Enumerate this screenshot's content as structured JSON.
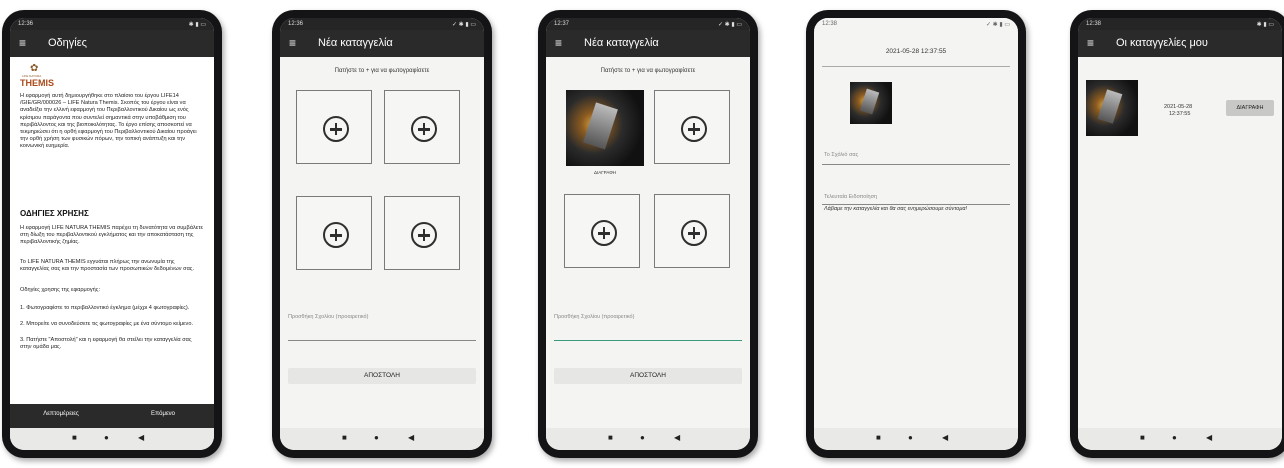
{
  "phones": [
    {
      "status_time": "12:36",
      "status_icons": "✱ ▮ ▭",
      "menu_icon": "≡",
      "title": "Οδηγίες",
      "logo_small": "LIFE NATURA",
      "logo_big": "THEMIS",
      "intro": "Η εφαρμογή αυτή δημιουργήθηκε στο πλαίσιο του έργου LIFE14 /GIE/GR/000026 – LIFE Natura Themis. Σκοπός του έργου είναι να αναδείξει την ελλινή εφαρμογή του Περιβαλλοντικού Δικαίου ως ενός κρίσιμου παράγοντα που συντελεί σημαντικά στην υποβάθμιση του περιβάλλοντος και της βιοποικιλότητας. Το έργο επίσης αποσκοπεί να τεκμηριώσει ότι η ορθή εφαρμογή του Περιβαλλοντικού Δικαίου προάγει την ορθή χρήση των φυσικών πόρων, την τοπική ανάπτυξη και την κοινωνική ευημερία.",
      "section_title": "ΟΔΗΓΙΕΣ ΧΡΗΣΗΣ",
      "para1": "Η εφαρμογή LIFE NATURA THEMIS παρέχει τη δυνατότητα να συμβάλετε στη δίωξη του περιβαλλοντικού εγκλήματος και την αποκατάσταση της περιβαλλοντικής ζημίας.",
      "para2": "Το LIFE NATURA THEMIS εγγυάται πλήρως την ανωνυμία της καταγγελίας σας και την προστασία των προσωπικών δεδομένων σας.",
      "para3": "Οδηγίες χρησης της εφαρμογής:",
      "step1": "1. Φωτογραφίστε το περιβαλλοντικό έγκλημα (μέχρι 4 φωτογραφίες).",
      "step2": "2. Μπορείτε να συνοδεύσετε τις φωτογραφίες με ένα σύντομο κείμενο.",
      "step3": "3. Πατήστε \"Αποστολή\" και η εφαρμογή θα στείλει την καταγγελία σας στην ομάδα μας.",
      "btn_left": "Λεπτομέρειες",
      "btn_right": "Επόμενο"
    },
    {
      "status_time": "12:36",
      "status_icons": "✓ ✱ ▮ ▭",
      "menu_icon": "≡",
      "title": "Νέα καταγγελία",
      "hint": "Πατήστε το + για να φωτογραφίσετε",
      "comment_placeholder": "Προσθήκη Σχολίου (προαιρετικό)",
      "send_button": "ΑΠΟΣΤΟΛΗ"
    },
    {
      "status_time": "12:37",
      "status_icons": "✓ ✱ ▮ ▭",
      "menu_icon": "≡",
      "title": "Νέα καταγγελία",
      "hint": "Πατήστε το + για να φωτογραφίσετε",
      "delete_caption": "ΔΙΑΓΡΑΦΗ",
      "comment_placeholder": "Προσθήκη Σχολίου (προαιρετικό)",
      "send_button": "ΑΠΟΣΤΟΛΗ"
    },
    {
      "status_time": "12:38",
      "status_icons": "✓ ✱ ▮ ▭",
      "datetime": "2021-05-28 12:37:55",
      "comment_label": "Το Σχόλιό σας",
      "last_update_label": "Τελευταία Ειδοποίηση",
      "last_update_text": "Λάβαμε την καταγγελία και θα σας ενημερώσουμε σύντομα!"
    },
    {
      "status_time": "12:38",
      "status_icons": "✱ ▮ ▭",
      "menu_icon": "≡",
      "title": "Οι καταγγελίες μου",
      "item_date": "2021-05-28",
      "item_time": "12:37:55",
      "delete_button": "ΔΙΑΓΡΑΦΗ"
    }
  ],
  "nav": {
    "recent": "■",
    "home": "●",
    "back": "◀"
  }
}
